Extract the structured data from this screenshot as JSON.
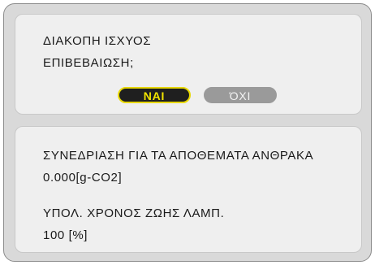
{
  "power_off_dialog": {
    "line1": "ΔΙΑΚΟΠΗ ΙΣΧΥΟΣ",
    "line2": "ΕΠΙΒΕΒΑΙΩΣΗ;",
    "yes_label": "ΝΑΙ",
    "no_label": "ΌΧΙ"
  },
  "info_panel": {
    "carbon_label": "ΣΥΝΕΔΡΙΑΣΗ ΓΙΑ ΤΑ ΑΠΟΘΕΜΑΤΑ ΑΝΘΡΑΚΑ",
    "carbon_value": "0.000[g-CO2]",
    "lamp_label": "ΥΠΟΛ. ΧΡΟΝΟΣ ΖΩΗΣ ΛΑΜΠ.",
    "lamp_value": "100 [%]"
  },
  "colors": {
    "dialog_bg": "#d9d9d9",
    "panel_bg": "#efefef",
    "selected_button_bg": "#1f1f1f",
    "selected_button_accent": "#e8d800",
    "unselected_button_bg": "#9a9a9a"
  }
}
